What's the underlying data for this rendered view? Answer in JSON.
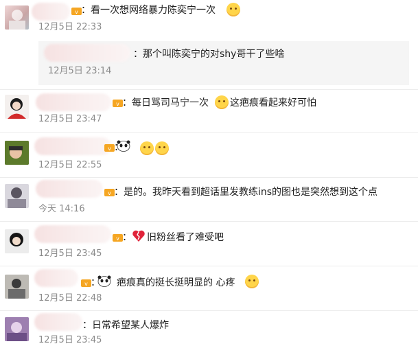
{
  "comments": [
    {
      "text": "：看一次想网络暴力陈奕宁一次",
      "time": "12月5日 22:33"
    },
    {
      "text": "：那个叫陈奕宁的对shy哥干了些啥",
      "time": "12月5日 23:14"
    },
    {
      "text": "：每日骂司马宁一次",
      "text2": "这疤痕看起来好可怕",
      "time": "12月5日 23:47"
    },
    {
      "text": "：",
      "time": "12月5日 22:55"
    },
    {
      "text": "：是的。我昨天看到超话里发教练ins的图也是突然想到这个点",
      "time": "今天 14:16"
    },
    {
      "text": "：",
      "text2": "旧粉丝看了难受吧",
      "time": "12月5日 23:45"
    },
    {
      "text": "：",
      "text2": "疤痕真的挺长挺明显的 心疼",
      "time": "12月5日 22:48"
    },
    {
      "text": "：日常希望某人爆炸",
      "time": "12月5日 23:45"
    }
  ],
  "colors": {
    "vip_badge": "#f5a623",
    "divider": "#ececec",
    "reply_bg": "#f5f5f5"
  },
  "icons": [
    "vip-badge-icon",
    "smile-emoji-icon",
    "panda-emoji-icon",
    "broken-heart-emoji-icon"
  ]
}
